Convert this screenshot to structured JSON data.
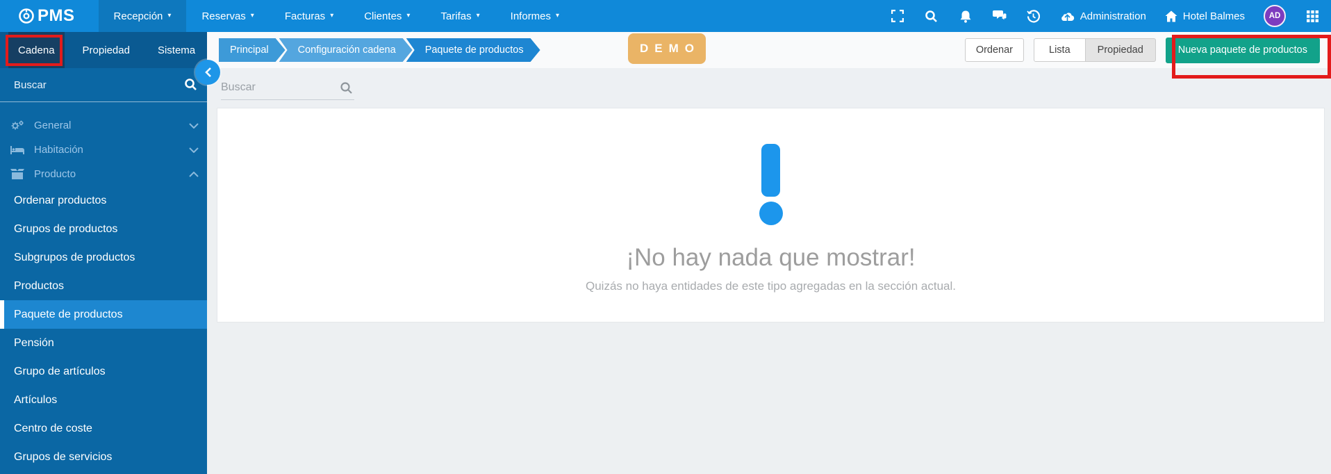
{
  "navbar": {
    "logo_text": "PMS",
    "items": [
      {
        "label": "Recepción"
      },
      {
        "label": "Reservas"
      },
      {
        "label": "Facturas"
      },
      {
        "label": "Clientes"
      },
      {
        "label": "Tarifas"
      },
      {
        "label": "Informes"
      }
    ],
    "caret": "▾",
    "right": {
      "administration_label": "Administration",
      "hotel_label": "Hotel Balmes",
      "avatar_initials": "AD"
    }
  },
  "sidebar": {
    "tabs": [
      {
        "label": "Cadena"
      },
      {
        "label": "Propiedad"
      },
      {
        "label": "Sistema"
      }
    ],
    "search_placeholder": "Buscar",
    "groups": [
      {
        "label": "General"
      },
      {
        "label": "Habitación"
      },
      {
        "label": "Producto"
      }
    ],
    "product_items": [
      {
        "label": "Ordenar productos"
      },
      {
        "label": "Grupos de productos"
      },
      {
        "label": "Subgrupos de productos"
      },
      {
        "label": "Productos"
      },
      {
        "label": "Paquete de productos"
      },
      {
        "label": "Pensión"
      },
      {
        "label": "Grupo de artículos"
      },
      {
        "label": "Artículos"
      },
      {
        "label": "Centro de coste"
      },
      {
        "label": "Grupos de servicios"
      }
    ]
  },
  "breadcrumb": {
    "items": [
      {
        "label": "Principal"
      },
      {
        "label": "Configuración cadena"
      },
      {
        "label": "Paquete de productos"
      }
    ]
  },
  "demo_badge": "DEMO",
  "toolbar": {
    "ordenar_label": "Ordenar",
    "lista_label": "Lista",
    "propiedad_label": "Propiedad",
    "new_button_label": "Nueva paquete de productos"
  },
  "main": {
    "search_placeholder": "Buscar",
    "empty_title": "¡No hay nada que mostrar!",
    "empty_subtitle": "Quizás no haya entidades de este tipo agregadas en la sección actual."
  },
  "colors": {
    "topbar_blue": "#1089d9",
    "tabs_row_blue": "#0a5a92",
    "active_tab_blue": "#163f63",
    "sidebar_blue": "#0b67a4",
    "selected_item_blue": "#1d87d0",
    "accent_blue": "#1c96ec",
    "breadcrumb_1": "#3d9ad8",
    "breadcrumb_2": "#54a6df",
    "breadcrumb_3": "#1e86d2",
    "demo_orange": "#eab466",
    "new_button_green": "#12a28a",
    "annotation_red": "#e31b1b",
    "avatar_purple": "#7d3cbf"
  }
}
